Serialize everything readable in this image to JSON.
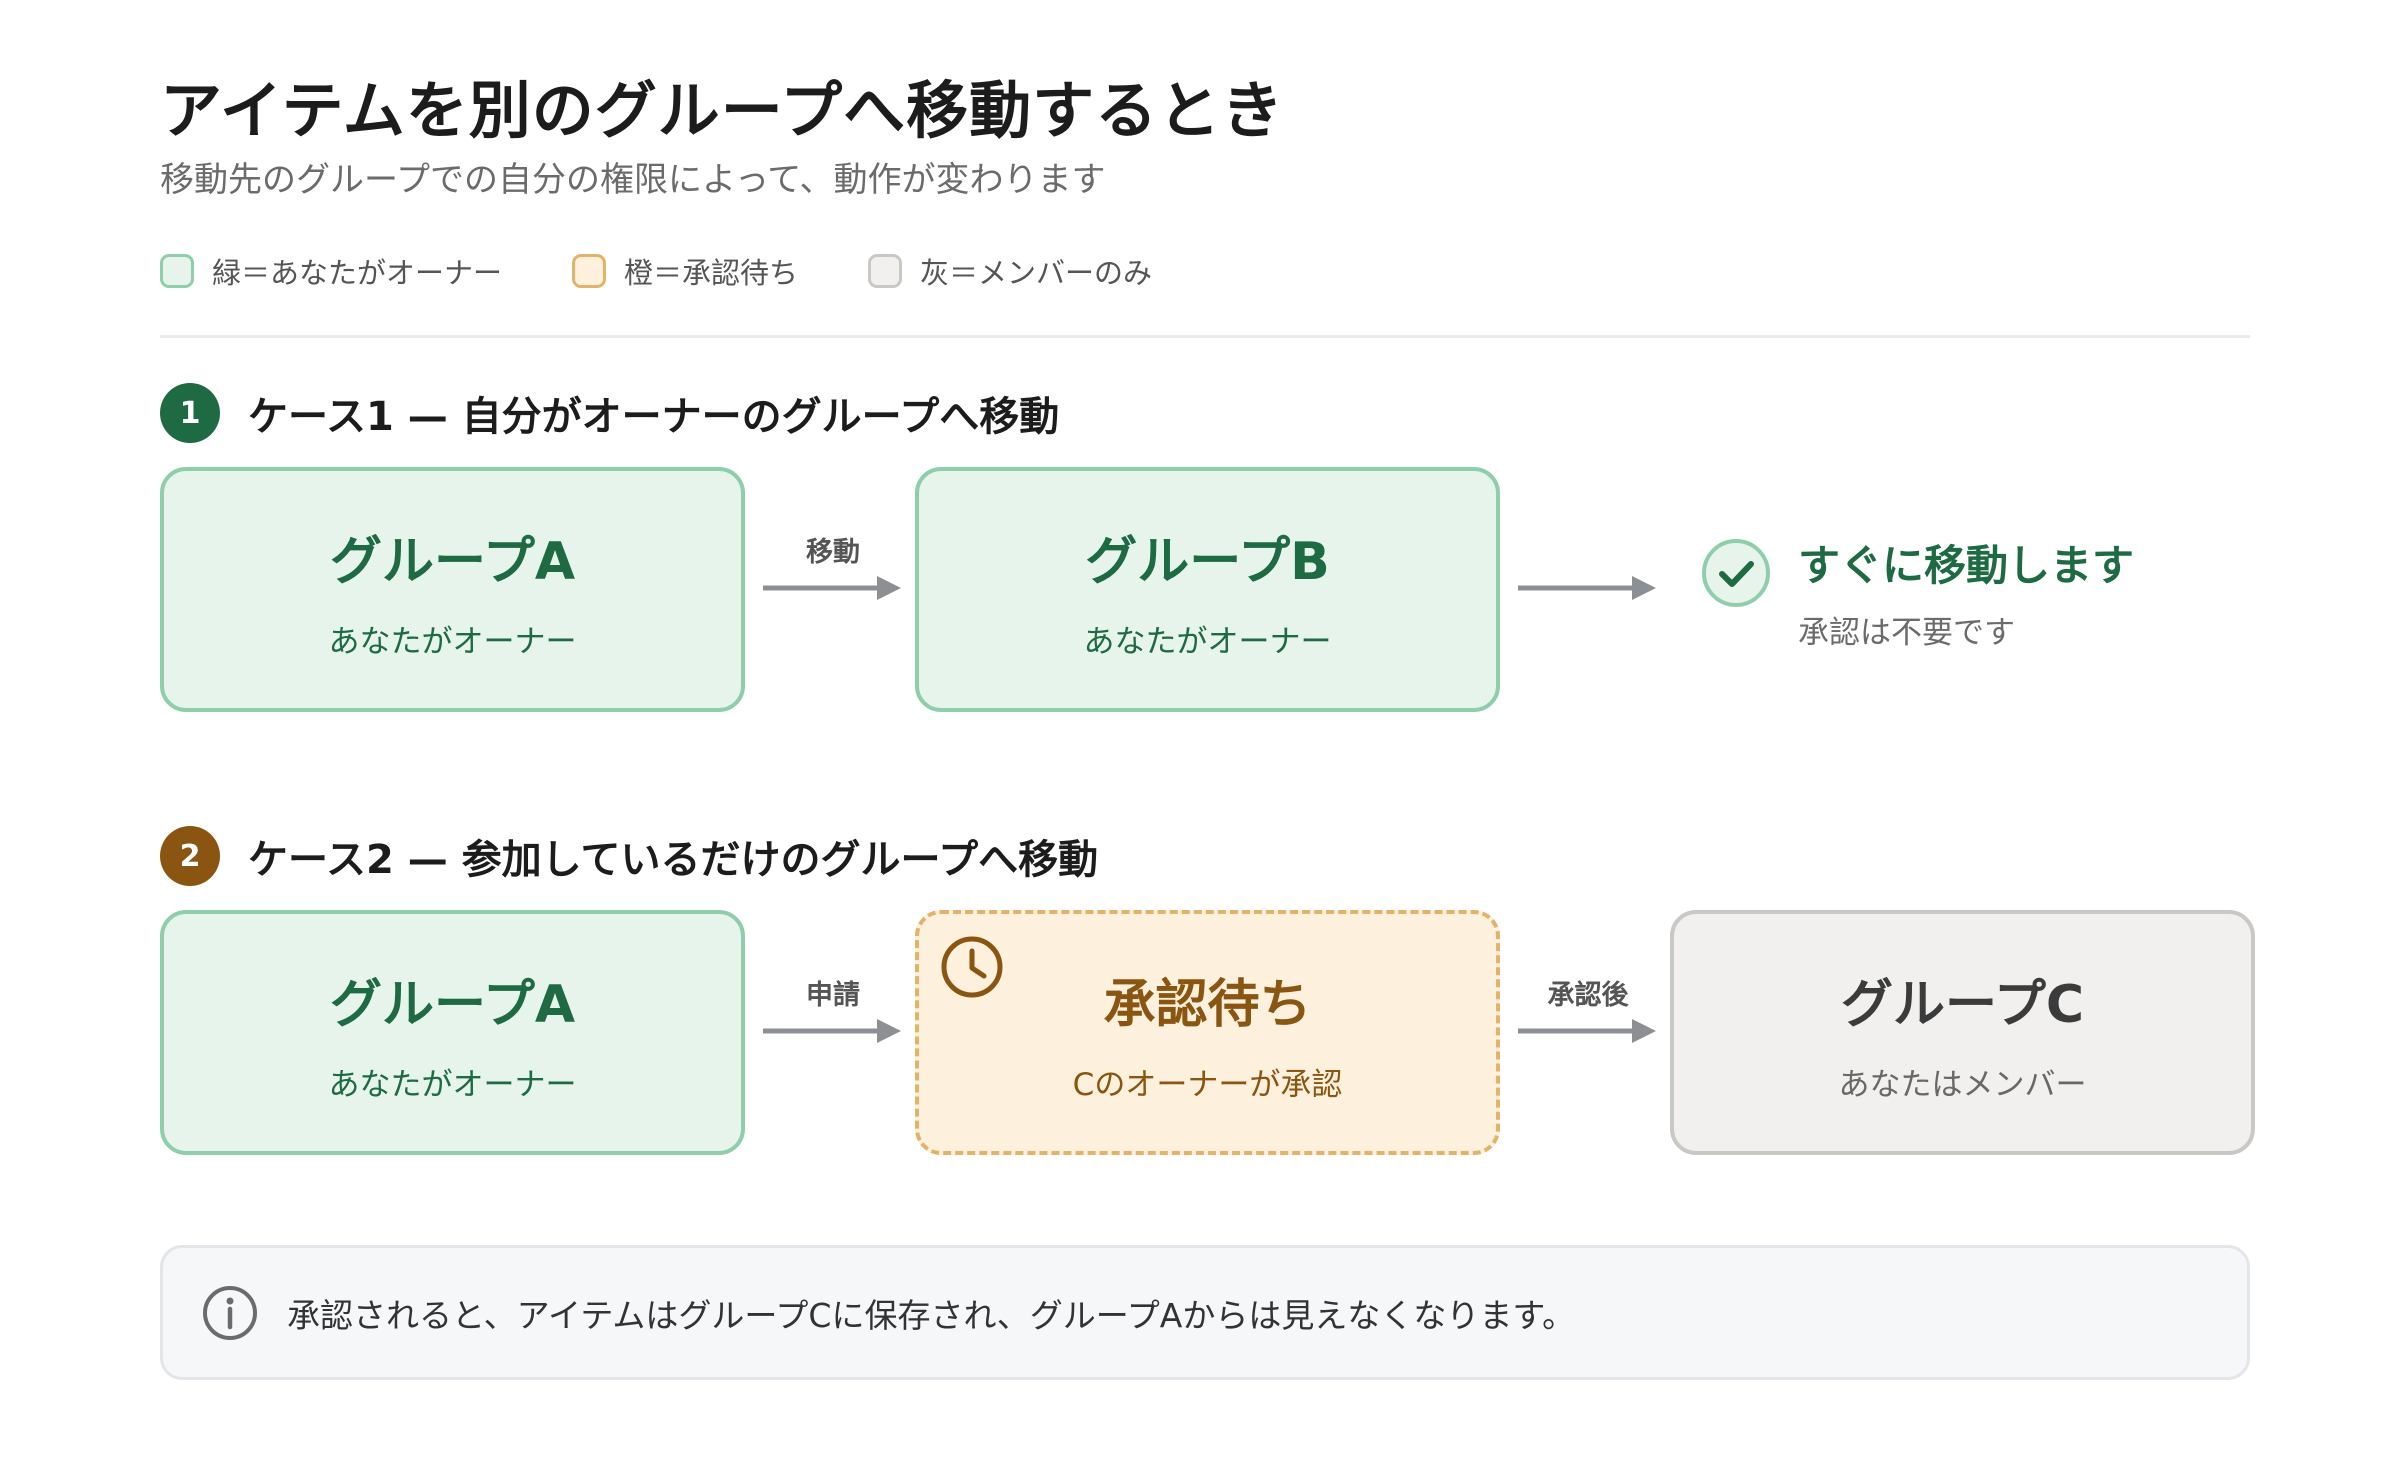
{
  "header": {
    "title": "アイテムを別のグループへ移動するとき",
    "subtitle": "移動先のグループでの自分の権限によって、動作が変わります"
  },
  "legend": [
    {
      "label": "緑＝あなたがオーナー",
      "fill": "#e7f4ec",
      "border": "#8fceaa"
    },
    {
      "label": "橙＝承認待ち",
      "fill": "#fdf0dc",
      "border": "#e3b36a"
    },
    {
      "label": "灰＝メンバーのみ",
      "fill": "#f1f0ee",
      "border": "#c9c8c4"
    }
  ],
  "case1": {
    "number": "1",
    "title": "ケース1 — 自分がオーナーのグループへ移動",
    "source": {
      "title": "グループA",
      "sub": "あなたがオーナー"
    },
    "arrow_label": "移動",
    "target": {
      "title": "グループB",
      "sub": "あなたがオーナー"
    },
    "result": {
      "title": "すぐに移動します",
      "sub": "承認は不要です",
      "icon": "check-circle-icon"
    }
  },
  "case2": {
    "number": "2",
    "title": "ケース2 — 参加しているだけのグループへ移動",
    "source": {
      "title": "グループA",
      "sub": "あなたがオーナー"
    },
    "arrow1_label": "申請",
    "pending": {
      "title": "承認待ち",
      "sub": "Cのオーナーが承認",
      "icon": "clock-icon"
    },
    "arrow2_label": "承認後",
    "target": {
      "title": "グループC",
      "sub": "あなたはメンバー"
    }
  },
  "note": {
    "icon": "info-icon",
    "text": "承認されると、アイテムはグループCに保存され、グループAからは見えなくなります。"
  },
  "colors": {
    "case1_badge": "#1d6a43",
    "case2_badge": "#8a5510",
    "arrow": "#8c8f94"
  }
}
